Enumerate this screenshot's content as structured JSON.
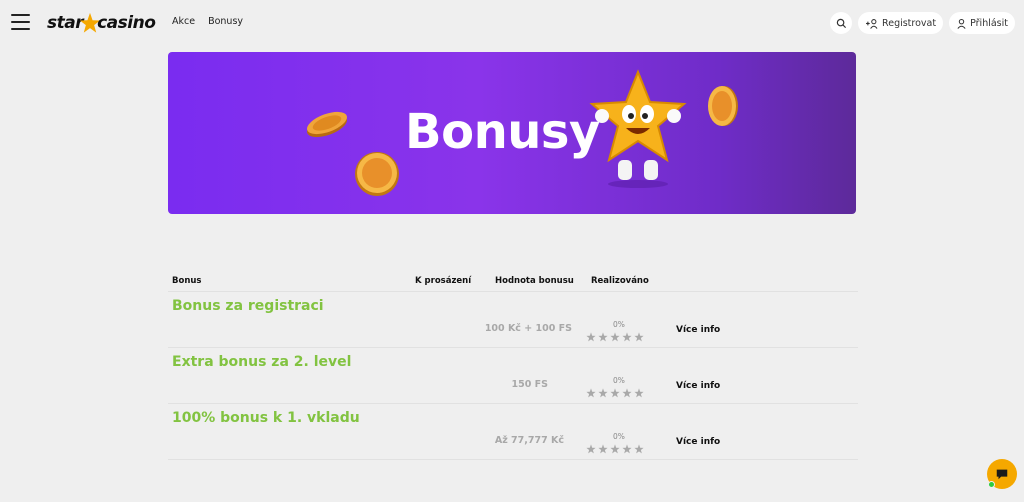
{
  "header": {
    "logo": {
      "part1": "star",
      "part2": "casino"
    },
    "nav": [
      "Akce",
      "Bonusy"
    ],
    "register_label": "Registrovat",
    "login_label": "Přihlásit"
  },
  "hero": {
    "title": "Bonusy"
  },
  "table": {
    "headers": {
      "bonus": "Bonus",
      "wager": "K prosázení",
      "value": "Hodnota bonusu",
      "realized": "Realizováno"
    },
    "rows": [
      {
        "title": "Bonus za registraci",
        "value": "100 Kč + 100 FS",
        "percent": "0%",
        "more": "Více info"
      },
      {
        "title": "Extra bonus za 2. level",
        "value": "150 FS",
        "percent": "0%",
        "more": "Více info"
      },
      {
        "title": "100% bonus k 1. vkladu",
        "value": "Až 77,777 Kč",
        "percent": "0%",
        "more": "Více info"
      }
    ]
  },
  "colors": {
    "accent_green": "#82c341",
    "hero_purple": "#7a2cf0",
    "star_gold": "#f5a800"
  }
}
